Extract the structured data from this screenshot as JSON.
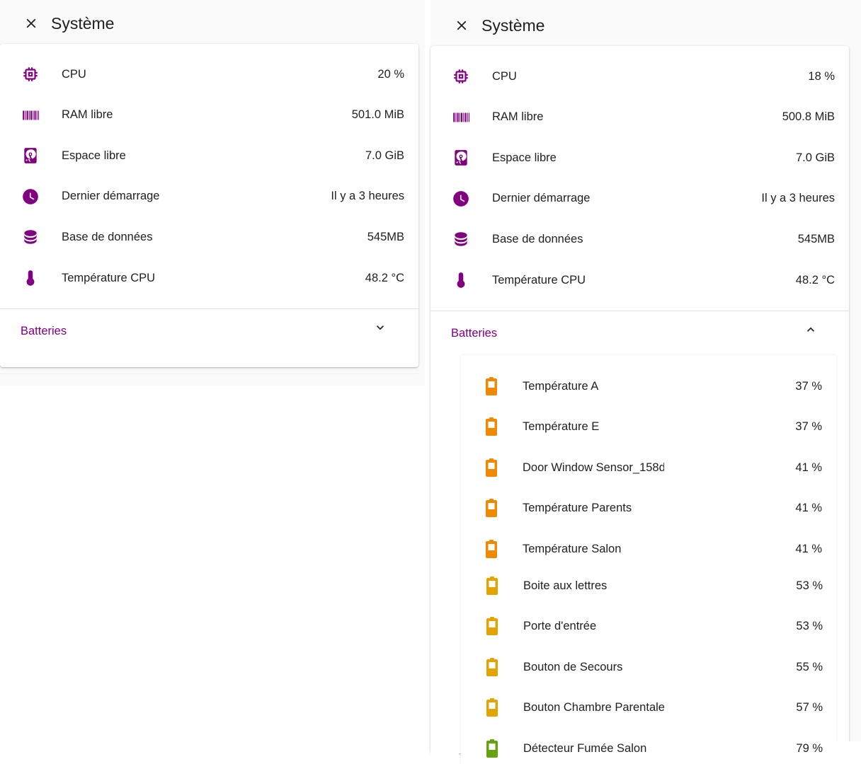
{
  "header": {
    "title": "Système",
    "close_icon": "close-icon"
  },
  "colors": {
    "accent": "#800080",
    "battery_low": "#ef8a00",
    "battery_mid": "#e3a400",
    "battery_good": "#65a30d"
  },
  "left_panel": {
    "system_items": [
      {
        "icon": "cpu-icon",
        "label": "CPU",
        "value": "20 %"
      },
      {
        "icon": "barcode-icon",
        "label": "RAM libre",
        "value": "501.0 MiB"
      },
      {
        "icon": "harddisk-icon",
        "label": "Espace libre",
        "value": "7.0 GiB"
      },
      {
        "icon": "clock-icon",
        "label": "Dernier démarrage",
        "value": "Il y a 3 heures"
      },
      {
        "icon": "database-icon",
        "label": "Base de données",
        "value": "545MB"
      },
      {
        "icon": "thermometer-icon",
        "label": "Température CPU",
        "value": "48.2 °C"
      }
    ],
    "batteries": {
      "title": "Batteries",
      "expanded": false
    }
  },
  "right_panel": {
    "system_items": [
      {
        "icon": "cpu-icon",
        "label": "CPU",
        "value": "18 %"
      },
      {
        "icon": "barcode-icon",
        "label": "RAM libre",
        "value": "500.8 MiB"
      },
      {
        "icon": "harddisk-icon",
        "label": "Espace libre",
        "value": "7.0 GiB"
      },
      {
        "icon": "clock-icon",
        "label": "Dernier démarrage",
        "value": "Il y a 3 heures"
      },
      {
        "icon": "database-icon",
        "label": "Base de données",
        "value": "545MB"
      },
      {
        "icon": "thermometer-icon",
        "label": "Température CPU",
        "value": "48.2 °C"
      }
    ],
    "batteries": {
      "title": "Batteries",
      "expanded": true,
      "items": [
        {
          "label": "Température A",
          "value": "37 %",
          "level": 0.37
        },
        {
          "label": "Température E",
          "value": "37 %",
          "level": 0.37
        },
        {
          "label": "Door Window Sensor_158d",
          "value": "41 %",
          "level": 0.41
        },
        {
          "label": "Température Parents",
          "value": "41 %",
          "level": 0.41
        },
        {
          "label": "Température Salon",
          "value": "41 %",
          "level": 0.41
        },
        {
          "label": "Boite aux lettres",
          "value": "53 %",
          "level": 0.53
        },
        {
          "label": "Porte d'entrée",
          "value": "53 %",
          "level": 0.53
        },
        {
          "label": "Bouton de Secours",
          "value": "55 %",
          "level": 0.55
        },
        {
          "label": "Bouton Chambre Parentale",
          "value": "57 %",
          "level": 0.57
        },
        {
          "label": "Détecteur Fumée Salon",
          "value": "79 %",
          "level": 0.79
        }
      ]
    }
  }
}
